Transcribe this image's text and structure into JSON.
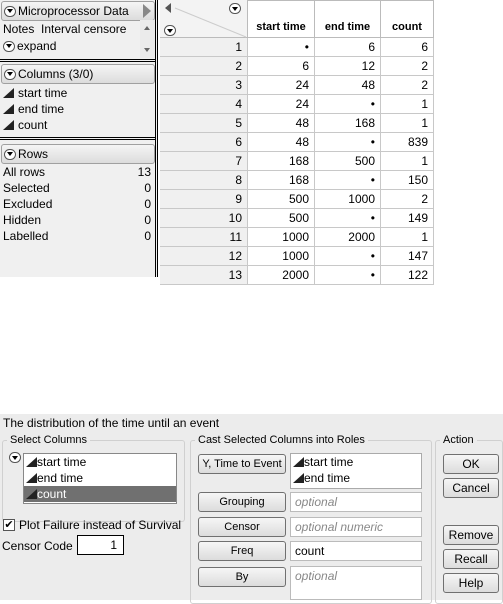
{
  "left_panel": {
    "table_title": "Microprocessor Data",
    "notes_label": "Notes",
    "notes_value": "Interval censored le",
    "expand_label": "expand",
    "columns_header": "Columns (3/0)",
    "columns": [
      "start time",
      "end time",
      "count"
    ],
    "rows_header": "Rows",
    "row_states": [
      {
        "label": "All rows",
        "value": "13"
      },
      {
        "label": "Selected",
        "value": "0"
      },
      {
        "label": "Excluded",
        "value": "0"
      },
      {
        "label": "Hidden",
        "value": "0"
      },
      {
        "label": "Labelled",
        "value": "0"
      }
    ]
  },
  "table": {
    "headers": [
      "start time",
      "end time",
      "count"
    ],
    "rows": [
      [
        "1",
        "•",
        "6",
        "6"
      ],
      [
        "2",
        "6",
        "12",
        "2"
      ],
      [
        "3",
        "24",
        "48",
        "2"
      ],
      [
        "4",
        "24",
        "•",
        "1"
      ],
      [
        "5",
        "48",
        "168",
        "1"
      ],
      [
        "6",
        "48",
        "•",
        "839"
      ],
      [
        "7",
        "168",
        "500",
        "1"
      ],
      [
        "8",
        "168",
        "•",
        "150"
      ],
      [
        "9",
        "500",
        "1000",
        "2"
      ],
      [
        "10",
        "500",
        "•",
        "149"
      ],
      [
        "11",
        "1000",
        "2000",
        "1"
      ],
      [
        "12",
        "1000",
        "•",
        "147"
      ],
      [
        "13",
        "2000",
        "•",
        "122"
      ]
    ]
  },
  "dialog": {
    "description": "The distribution of the time until an event",
    "select_columns_title": "Select Columns",
    "select_columns": [
      "start time",
      "end time",
      "count"
    ],
    "selected_column": "count",
    "plot_failure_label": "Plot Failure instead of Survival",
    "plot_failure_checked": true,
    "censor_code_label": "Censor Code",
    "censor_code_value": "1",
    "cast_title": "Cast Selected Columns into Roles",
    "roles": {
      "y_label": "Y, Time to Event",
      "y_values": [
        "start time",
        "end time"
      ],
      "grouping_label": "Grouping",
      "grouping_placeholder": "optional",
      "censor_label": "Censor",
      "censor_placeholder": "optional numeric",
      "freq_label": "Freq",
      "freq_value": "count",
      "by_label": "By",
      "by_placeholder": "optional"
    },
    "action_title": "Action",
    "actions": {
      "ok": "OK",
      "cancel": "Cancel",
      "remove": "Remove",
      "recall": "Recall",
      "help": "Help"
    }
  }
}
